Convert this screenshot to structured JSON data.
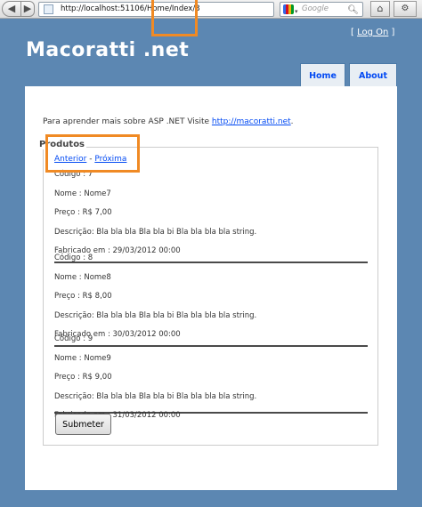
{
  "browser": {
    "url": "http://localhost:51106/Home/Index/3",
    "search_placeholder": "Google",
    "back_label": "◀",
    "forward_label": "▶",
    "reload_label": "↻",
    "star_label": "☆",
    "home_label": "⌂",
    "misc_label": "⚙"
  },
  "site": {
    "title": "Macoratti .net",
    "login_open": "[ ",
    "login_link": "Log On",
    "login_close": " ]"
  },
  "menu": {
    "home": "Home",
    "about": "About"
  },
  "main": {
    "intro_text": "Para aprender mais sobre ASP .NET Visite ",
    "intro_link": "http://macoratti.net",
    "intro_end": "."
  },
  "products_section": {
    "legend": "Produtos",
    "prev_link": "Anterior",
    "separator": " - ",
    "next_link": "Próxima",
    "submit_label": "Submeter"
  },
  "products": [
    {
      "codigo": "Código : 7",
      "nome": "Nome : Nome7",
      "preco": "Preço : R$ 7,00",
      "descricao": "Descrição: Bla bla bla Bla bla bi Bla bla bla bla string.",
      "fabricado": "Fabricado em : 29/03/2012 00:00"
    },
    {
      "codigo": "Código : 8",
      "nome": "Nome : Nome8",
      "preco": "Preço : R$ 8,00",
      "descricao": "Descrição: Bla bla bla Bla bla bi Bla bla bla bla string.",
      "fabricado": "Fabricado em : 30/03/2012 00:00"
    },
    {
      "codigo": "Código : 9",
      "nome": "Nome : Nome9",
      "preco": "Preço : R$ 9,00",
      "descricao": "Descrição: Bla bla bla Bla bla bi Bla bla bla bla string.",
      "fabricado": "Fabricado em : 31/03/2012 00:00"
    }
  ],
  "colors": {
    "page_background": "#5c87b2",
    "link": "#034af3",
    "highlight": "#f08a24"
  }
}
